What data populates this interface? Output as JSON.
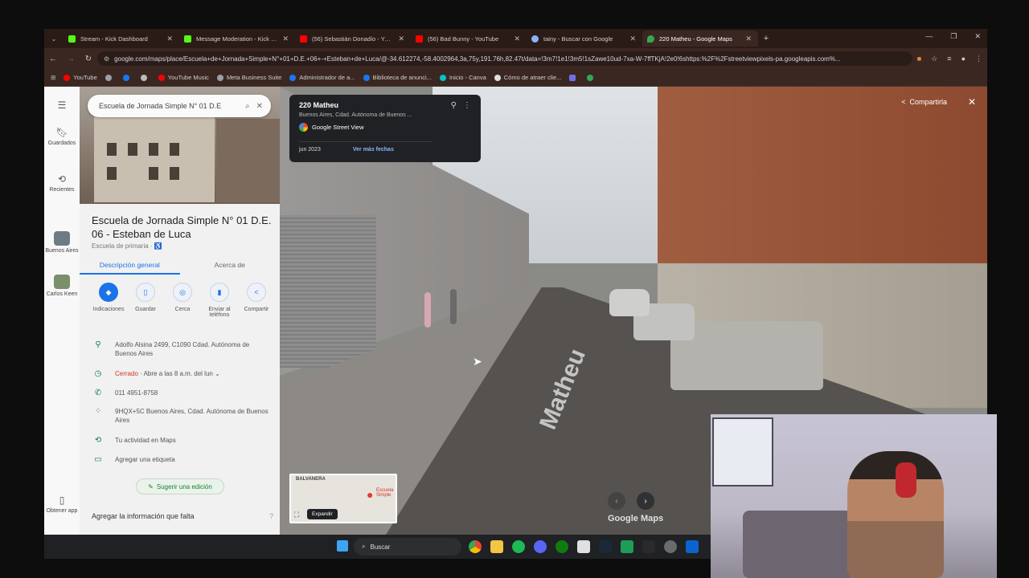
{
  "browser": {
    "tabs": [
      {
        "title": "Stream - Kick Dashboard",
        "color": "#53fc18"
      },
      {
        "title": "Message Moderation - Kick Da",
        "color": "#53fc18"
      },
      {
        "title": "(56) Sebastián Donadío - YouTub",
        "color": "#ff0000"
      },
      {
        "title": "(56) Bad Bunny - YouTube",
        "color": "#ff0000"
      },
      {
        "title": "tainy - Buscar con Google",
        "color": "#8ab4f8"
      },
      {
        "title": "220 Matheu - Google Maps",
        "color": "#34a853"
      }
    ],
    "new_tab": "+",
    "url": "google.com/maps/place/Escuela+de+Jornada+Simple+N°+01+D.E.+06+-+Esteban+de+Luca/@-34.612274,-58.4002964,3a,75y,191.76h,82.47t/data=!3m7!1e1!3m5!1sZawe10ud-7xa-W-7ffTKjA!2e0!6shttps:%2F%2Fstreetviewpixels-pa.googleapis.com%...",
    "bookmarks": [
      {
        "label": "YouTube",
        "color": "#ff0000"
      },
      {
        "label": "",
        "color": "#9aa0a6"
      },
      {
        "label": "",
        "color": "#1877f2"
      },
      {
        "label": "",
        "color": "#bbbbbb"
      },
      {
        "label": "YouTube Music",
        "color": "#ff0000"
      },
      {
        "label": "Meta Business Suite",
        "color": "#9aa0a6"
      },
      {
        "label": "Administrador de a...",
        "color": "#1877f2"
      },
      {
        "label": "Biblioteca de anunci...",
        "color": "#1877f2"
      },
      {
        "label": "Inicio - Canva",
        "color": "#00c4cc"
      },
      {
        "label": "Cómo de atraer clie...",
        "color": "#e0e0e0"
      },
      {
        "label": "",
        "color": "#6e6ee8"
      },
      {
        "label": "",
        "color": "#34a853"
      }
    ]
  },
  "rail": {
    "saved": "Guardados",
    "recent": "Recientes",
    "place1": "Buenos Aires",
    "place2": "Carlos Keen",
    "get_app": "Obtener app"
  },
  "panel": {
    "search_query": "Escuela de Jornada Simple N° 01 D.E",
    "title": "Escuela de Jornada Simple N° 01 D.E. 06 - Esteban de Luca",
    "subtitle": "Escuela de primaria · ♿",
    "tabs": [
      "Descripción general",
      "Acerca de"
    ],
    "actions": [
      "Indicaciones",
      "Guardar",
      "Cerca",
      "Enviar al teléfono",
      "Compartir"
    ],
    "address": "Adolfo Alsina 2499, C1090 Cdad. Autónoma de Buenos Aires",
    "hours_status": "Cerrado",
    "hours_detail": " · Abre a las 8 a.m. del lun",
    "phone": "011 4951-8758",
    "plus_code": "9HQX+5C Buenos Aires, Cdad. Autónoma de Buenos Aires",
    "activity": "Tu actividad en Maps",
    "add_label": "Agregar una etiqueta",
    "suggest_edit": "Sugerir una edición",
    "missing_info": "Agregar la información que falta"
  },
  "streetview": {
    "card_address": "220 Matheu",
    "card_city": "Buenos Aires, Cdad. Autónoma de Buenos ...",
    "card_source": "Google Street View",
    "card_date": "jun 2023",
    "card_more": "Ver más fechas",
    "share": "Compartirla",
    "street_name": "Matheu",
    "minimap_label1": "BALVANERA",
    "minimap_label2": "Escuela Simple",
    "expand": "Expandir",
    "logo": "Google Maps"
  },
  "taskbar": {
    "search": "Buscar"
  }
}
